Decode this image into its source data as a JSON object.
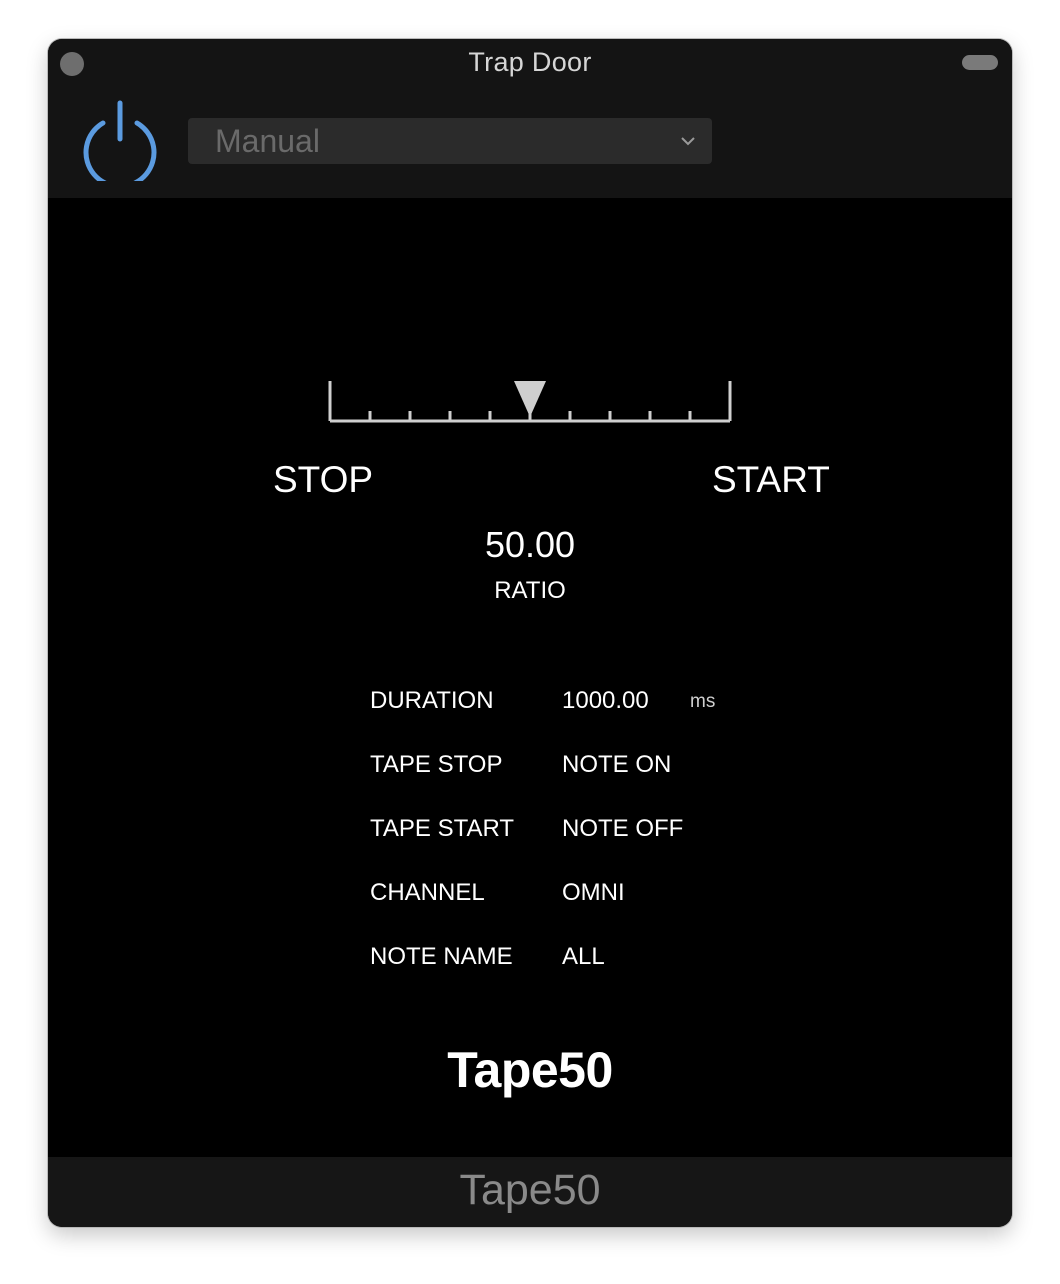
{
  "window": {
    "title": "Trap Door"
  },
  "header": {
    "preset": "Manual"
  },
  "slider": {
    "left_label": "STOP",
    "right_label": "START",
    "position_fraction": 0.5,
    "ticks": 11
  },
  "ratio": {
    "value": "50.00",
    "label": "RATIO"
  },
  "params": [
    {
      "name": "DURATION",
      "value": "1000.00",
      "unit": "ms"
    },
    {
      "name": "TAPE STOP",
      "value": "NOTE ON"
    },
    {
      "name": "TAPE START",
      "value": "NOTE OFF"
    },
    {
      "name": "CHANNEL",
      "value": "OMNI"
    },
    {
      "name": "NOTE NAME",
      "value": "ALL"
    }
  ],
  "brand": "Tape50",
  "footer": {
    "plugin_name": "Tape50"
  },
  "colors": {
    "accent": "#5b9be0",
    "background": "#000000",
    "chrome": "#141414"
  },
  "icons": [
    "power-icon",
    "chevron-down-icon",
    "close-dot-icon",
    "minimize-pill-icon"
  ]
}
